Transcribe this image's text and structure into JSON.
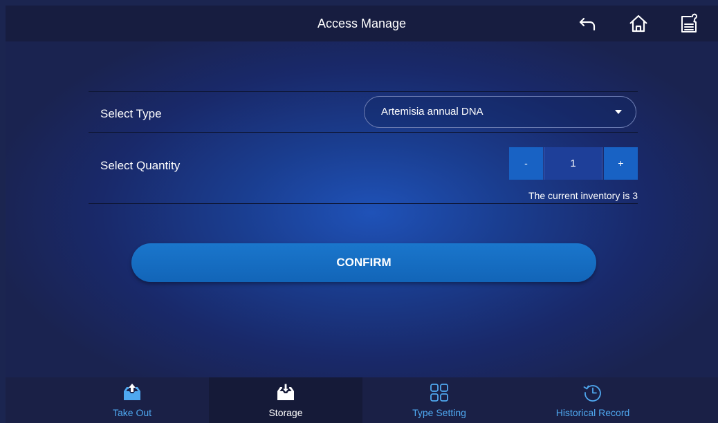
{
  "header": {
    "title": "Access Manage",
    "back_icon": "back-arrow-icon",
    "home_icon": "home-icon",
    "help_icon": "help-document-icon"
  },
  "form": {
    "type_label": "Select Type",
    "type_value": "Artemisia annual DNA",
    "quantity_label": "Select Quantity",
    "quantity_minus": "-",
    "quantity_value": "1",
    "quantity_plus": "+",
    "inventory_text": "The current inventory is 3",
    "confirm_label": "CONFIRM"
  },
  "tabs": [
    {
      "label": "Take Out",
      "icon": "take-out-tray-icon",
      "active": false
    },
    {
      "label": "Storage",
      "icon": "storage-tray-icon",
      "active": true
    },
    {
      "label": "Type Setting",
      "icon": "grid-icon",
      "active": false
    },
    {
      "label": "Historical Record",
      "icon": "history-clock-icon",
      "active": false
    }
  ],
  "colors": {
    "accent": "#1a76cc",
    "tab_label_active": "#4fa8f0",
    "topbar": "#171d40"
  }
}
